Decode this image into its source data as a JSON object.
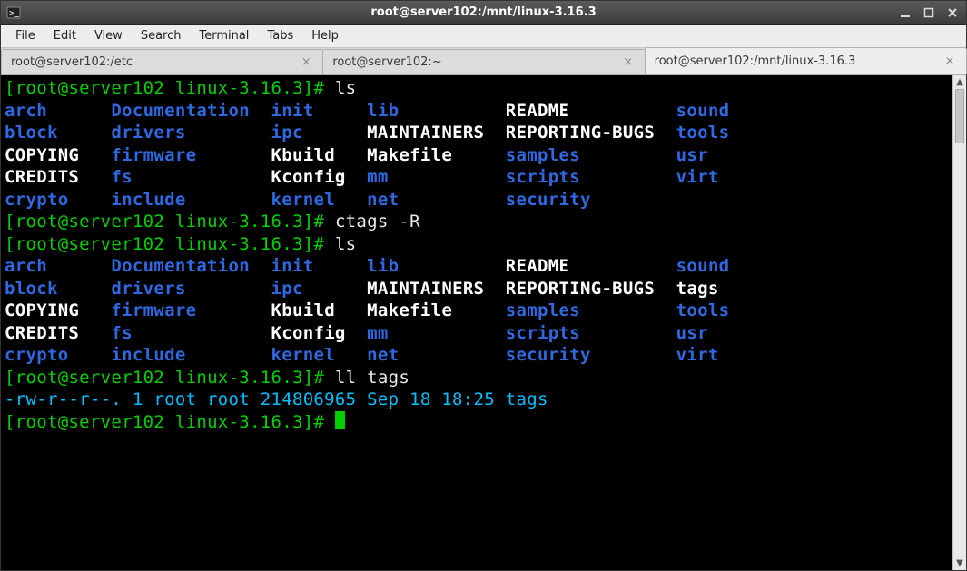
{
  "window": {
    "title": "root@server102:/mnt/linux-3.16.3"
  },
  "menu": {
    "file": "File",
    "edit": "Edit",
    "view": "View",
    "search": "Search",
    "terminal": "Terminal",
    "tabs": "Tabs",
    "help": "Help"
  },
  "tabs": [
    {
      "label": "root@server102:/etc"
    },
    {
      "label": "root@server102:~"
    },
    {
      "label": "root@server102:/mnt/linux-3.16.3"
    }
  ],
  "term": {
    "prompt_open": "[",
    "prompt_user": "root@server102",
    "prompt_dir": " linux-3.16.3",
    "prompt_close": "]# ",
    "cmd_ls": "ls",
    "cmd_ctags": "ctags -R",
    "cmd_ll": "ll tags",
    "ls1": {
      "r1c1": "arch",
      "r1c2": "Documentation",
      "r1c3": "init",
      "r1c4": "lib",
      "r1c5": "README",
      "r1c6": "sound",
      "r2c1": "block",
      "r2c2": "drivers",
      "r2c3": "ipc",
      "r2c4": "MAINTAINERS",
      "r2c5": "REPORTING-BUGS",
      "r2c6": "tools",
      "r3c1": "COPYING",
      "r3c2": "firmware",
      "r3c3": "Kbuild",
      "r3c4": "Makefile",
      "r3c5": "samples",
      "r3c6": "usr",
      "r4c1": "CREDITS",
      "r4c2": "fs",
      "r4c3": "Kconfig",
      "r4c4": "mm",
      "r4c5": "scripts",
      "r4c6": "virt",
      "r5c1": "crypto",
      "r5c2": "include",
      "r5c3": "kernel",
      "r5c4": "net",
      "r5c5": "security"
    },
    "ls2": {
      "r1c1": "arch",
      "r1c2": "Documentation",
      "r1c3": "init",
      "r1c4": "lib",
      "r1c5": "README",
      "r1c6": "sound",
      "r2c1": "block",
      "r2c2": "drivers",
      "r2c3": "ipc",
      "r2c4": "MAINTAINERS",
      "r2c5": "REPORTING-BUGS",
      "r2c6": "tags",
      "r3c1": "COPYING",
      "r3c2": "firmware",
      "r3c3": "Kbuild",
      "r3c4": "Makefile",
      "r3c5": "samples",
      "r3c6": "tools",
      "r4c1": "CREDITS",
      "r4c2": "fs",
      "r4c3": "Kconfig",
      "r4c4": "mm",
      "r4c5": "scripts",
      "r4c6": "usr",
      "r5c1": "crypto",
      "r5c2": "include",
      "r5c3": "kernel",
      "r5c4": "net",
      "r5c5": "security",
      "r5c6": "virt"
    },
    "ll_out": "-rw-r--r--. 1 root root 214806965 Sep 18 18:25 tags"
  },
  "colors": {
    "prompt": "#00d000",
    "dir": "#2f68e0",
    "file": "#ffffff",
    "output": "#00bfff"
  }
}
